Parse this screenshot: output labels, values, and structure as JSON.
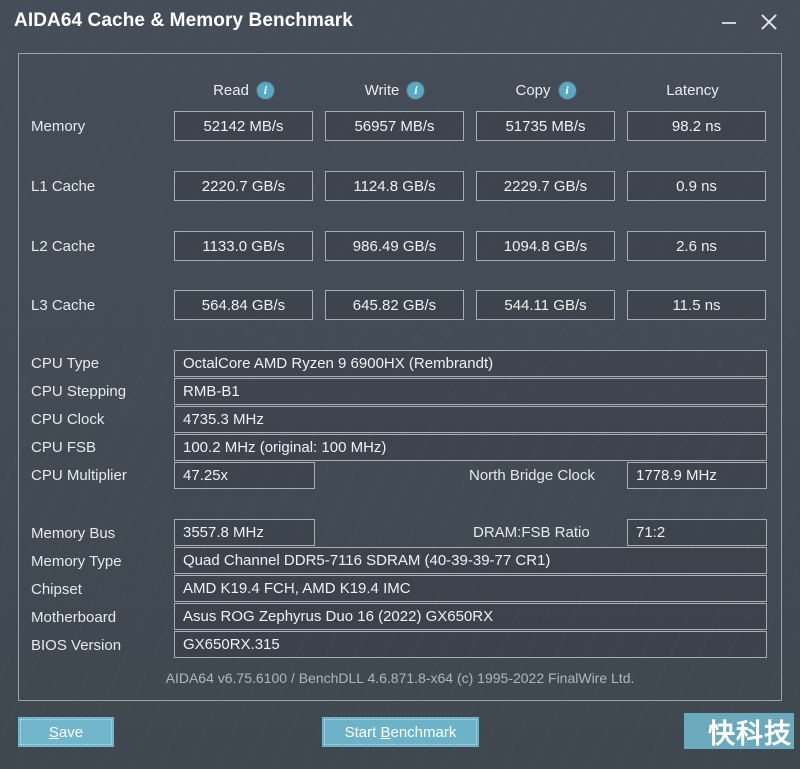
{
  "window": {
    "title": "AIDA64 Cache & Memory Benchmark",
    "minimize_label": "–",
    "close_label": "✕"
  },
  "benchmark": {
    "columns": [
      {
        "label": "Read",
        "has_info": true,
        "info_glyph": "i"
      },
      {
        "label": "Write",
        "has_info": true,
        "info_glyph": "i"
      },
      {
        "label": "Copy",
        "has_info": true,
        "info_glyph": "i"
      },
      {
        "label": "Latency",
        "has_info": false,
        "info_glyph": ""
      }
    ],
    "rows": [
      {
        "label": "Memory",
        "read": "52142 MB/s",
        "write": "56957 MB/s",
        "copy": "51735 MB/s",
        "latency": "98.2 ns"
      },
      {
        "label": "L1 Cache",
        "read": "2220.7 GB/s",
        "write": "1124.8 GB/s",
        "copy": "2229.7 GB/s",
        "latency": "0.9 ns"
      },
      {
        "label": "L2 Cache",
        "read": "1133.0 GB/s",
        "write": "986.49 GB/s",
        "copy": "1094.8 GB/s",
        "latency": "2.6 ns"
      },
      {
        "label": "L3 Cache",
        "read": "564.84 GB/s",
        "write": "645.82 GB/s",
        "copy": "544.11 GB/s",
        "latency": "11.5 ns"
      }
    ]
  },
  "cpu_info": {
    "type_label": "CPU Type",
    "type_value": "OctalCore AMD Ryzen 9 6900HX  (Rembrandt)",
    "stepping_label": "CPU Stepping",
    "stepping_value": "RMB-B1",
    "clock_label": "CPU Clock",
    "clock_value": "4735.3 MHz",
    "fsb_label": "CPU FSB",
    "fsb_value": "100.2 MHz  (original: 100 MHz)",
    "multiplier_label": "CPU Multiplier",
    "multiplier_value": "47.25x",
    "north_bridge_label": "North Bridge Clock",
    "north_bridge_value": "1778.9 MHz"
  },
  "memory_info": {
    "bus_label": "Memory Bus",
    "bus_value": "3557.8 MHz",
    "dram_fsb_label": "DRAM:FSB Ratio",
    "dram_fsb_value": "71:2",
    "type_label": "Memory Type",
    "type_value": "Quad Channel DDR5-7116 SDRAM  (40-39-39-77 CR1)",
    "chipset_label": "Chipset",
    "chipset_value": "AMD K19.4 FCH, AMD K19.4 IMC",
    "motherboard_label": "Motherboard",
    "motherboard_value": "Asus ROG Zephyrus Duo 16 (2022) GX650RX",
    "bios_label": "BIOS Version",
    "bios_value": "GX650RX.315"
  },
  "footer": {
    "version_text": "AIDA64 v6.75.6100 / BenchDLL 4.6.871.8-x64  (c) 1995-2022 FinalWire Ltd.",
    "save_button": {
      "prefix": "",
      "accel": "S",
      "suffix": "ave"
    },
    "start_button": {
      "prefix": "Start ",
      "accel": "B",
      "suffix": "enchmark"
    },
    "watermark": "快科技"
  },
  "colors": {
    "window_bg": "#434b55",
    "accent_teal": "#71b6cb",
    "info_icon": "#57a9c4",
    "border": "#a6aeb6",
    "text": "#eef2f5",
    "muted_text": "#aeb7c0"
  }
}
